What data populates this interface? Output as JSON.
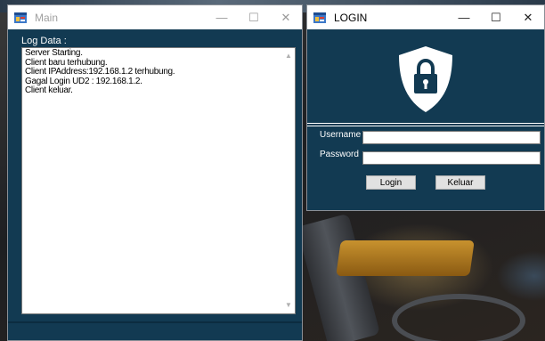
{
  "main_window": {
    "title": "Main",
    "controls": {
      "minimize": "—",
      "maximize": "☐",
      "close": "✕"
    },
    "log_label": "Log Data :",
    "log_lines": [
      "Server Starting.",
      "Client baru terhubung.",
      "Client IPAddress:192.168.1.2 terhubung.",
      "Gagal Login UD2 : 192.168.1.2.",
      "Client keluar."
    ],
    "scroll_up": "▲",
    "scroll_down": "▼"
  },
  "login_window": {
    "title": "LOGIN",
    "controls": {
      "minimize": "—",
      "maximize": "☐",
      "close": "✕"
    },
    "icon": "shield-lock-icon",
    "username_label": "Username",
    "username_value": "",
    "password_label": "Password",
    "password_value": "",
    "login_button": "Login",
    "exit_button": "Keluar"
  },
  "colors": {
    "window_bg": "#123a52",
    "titlebar_bg": "#ffffff",
    "text_light": "#ffffff"
  }
}
